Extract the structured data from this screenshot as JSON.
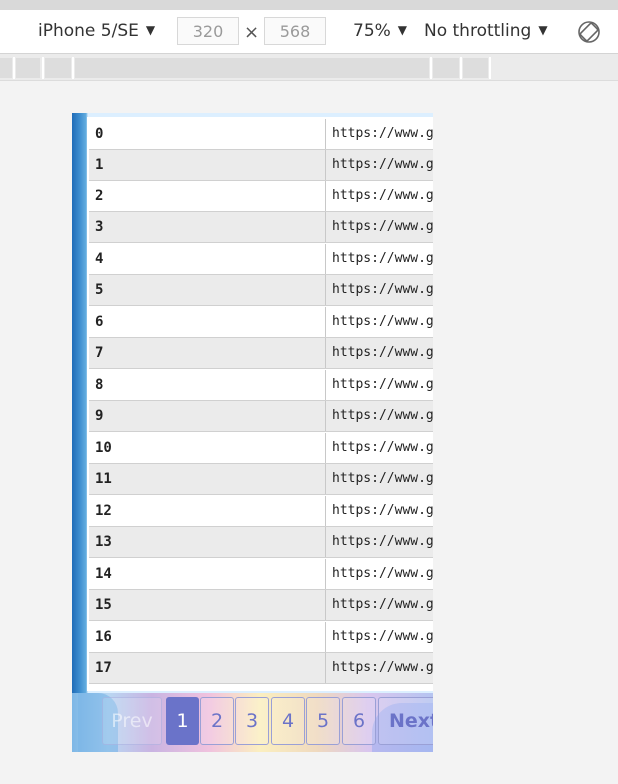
{
  "toolbar": {
    "device": "iPhone 5/SE",
    "width_value": "320",
    "times_symbol": "×",
    "height_value": "568",
    "zoom": "75%",
    "throttling": "No throttling",
    "dropdown_arrow": "▼",
    "rotate_icon": "rotate-icon"
  },
  "table": {
    "rows": [
      {
        "index": "0",
        "url": "https://www.gc"
      },
      {
        "index": "1",
        "url": "https://www.gc"
      },
      {
        "index": "2",
        "url": "https://www.gc"
      },
      {
        "index": "3",
        "url": "https://www.gc"
      },
      {
        "index": "4",
        "url": "https://www.gc"
      },
      {
        "index": "5",
        "url": "https://www.gc"
      },
      {
        "index": "6",
        "url": "https://www.gc"
      },
      {
        "index": "7",
        "url": "https://www.gc"
      },
      {
        "index": "8",
        "url": "https://www.gc"
      },
      {
        "index": "9",
        "url": "https://www.gc"
      },
      {
        "index": "10",
        "url": "https://www.gc"
      },
      {
        "index": "11",
        "url": "https://www.gc"
      },
      {
        "index": "12",
        "url": "https://www.gc"
      },
      {
        "index": "13",
        "url": "https://www.gc"
      },
      {
        "index": "14",
        "url": "https://www.gc"
      },
      {
        "index": "15",
        "url": "https://www.gc"
      },
      {
        "index": "16",
        "url": "https://www.gc"
      },
      {
        "index": "17",
        "url": "https://www.gc"
      }
    ]
  },
  "pagination": {
    "prev_label": "Prev",
    "pages": [
      "1",
      "2",
      "3",
      "4",
      "5",
      "6"
    ],
    "active_page": "1",
    "next_label": "Next"
  },
  "colors": {
    "active_page": "#6a73c9",
    "page_text": "#6b73c8",
    "row_alt": "#ebebeb",
    "viewport_edge": "#1f6cb8"
  }
}
